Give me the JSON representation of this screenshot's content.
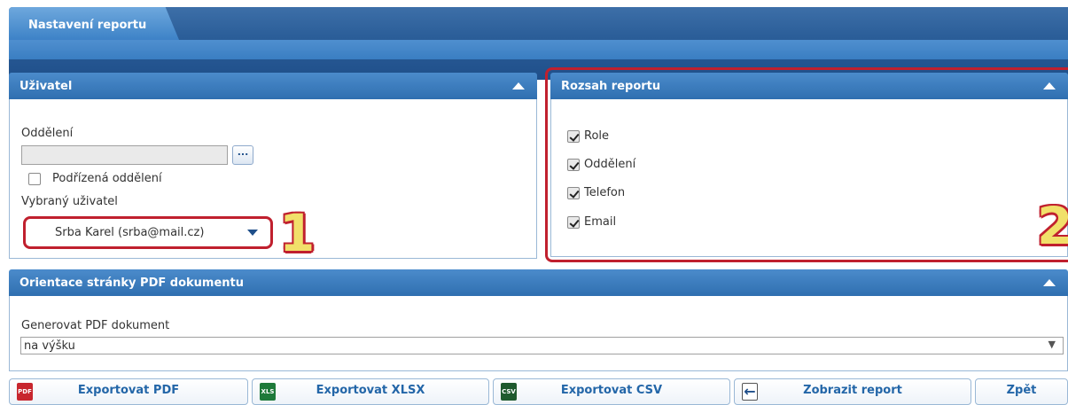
{
  "header": {
    "tab_label": "Nastavení reportu"
  },
  "user_panel": {
    "title": "Uživatel",
    "department_label": "Oddělení",
    "department_value": "",
    "browse_label": "...",
    "sub_departments_label": "Podřízená oddělení",
    "sub_departments_checked": false,
    "selected_user_label": "Vybraný uživatel",
    "selected_user_value": "Srba Karel (srba@mail.cz)"
  },
  "scope_panel": {
    "title": "Rozsah reportu",
    "options": [
      {
        "label": "Role",
        "checked": true
      },
      {
        "label": "Oddělení",
        "checked": true
      },
      {
        "label": "Telefon",
        "checked": true
      },
      {
        "label": "Email",
        "checked": true
      }
    ]
  },
  "orientation_panel": {
    "title": "Orientace stránky PDF dokumentu",
    "generate_label": "Generovat PDF dokument",
    "generate_value": "na výšku",
    "dropdown_caret": "▼"
  },
  "annotations": {
    "marker_1": "1",
    "marker_2": "2"
  },
  "footer": {
    "buttons": [
      {
        "label": "Exportovat PDF",
        "icon": "pdf-icon",
        "icon_text": "PDF"
      },
      {
        "label": "Exportovat XLSX",
        "icon": "xls-icon",
        "icon_text": "XLS"
      },
      {
        "label": "Exportovat CSV",
        "icon": "csv-icon",
        "icon_text": "CSV"
      },
      {
        "label": "Zobrazit report",
        "icon": "back-arrow-icon"
      },
      {
        "label": "Zpět"
      }
    ]
  },
  "colors": {
    "header_blue": "#2b5e99",
    "panel_header_blue": "#3f7fc0",
    "highlight_red": "#c0202e",
    "annotation_yellow": "#f1e06a",
    "button_text_blue": "#2366a8"
  }
}
